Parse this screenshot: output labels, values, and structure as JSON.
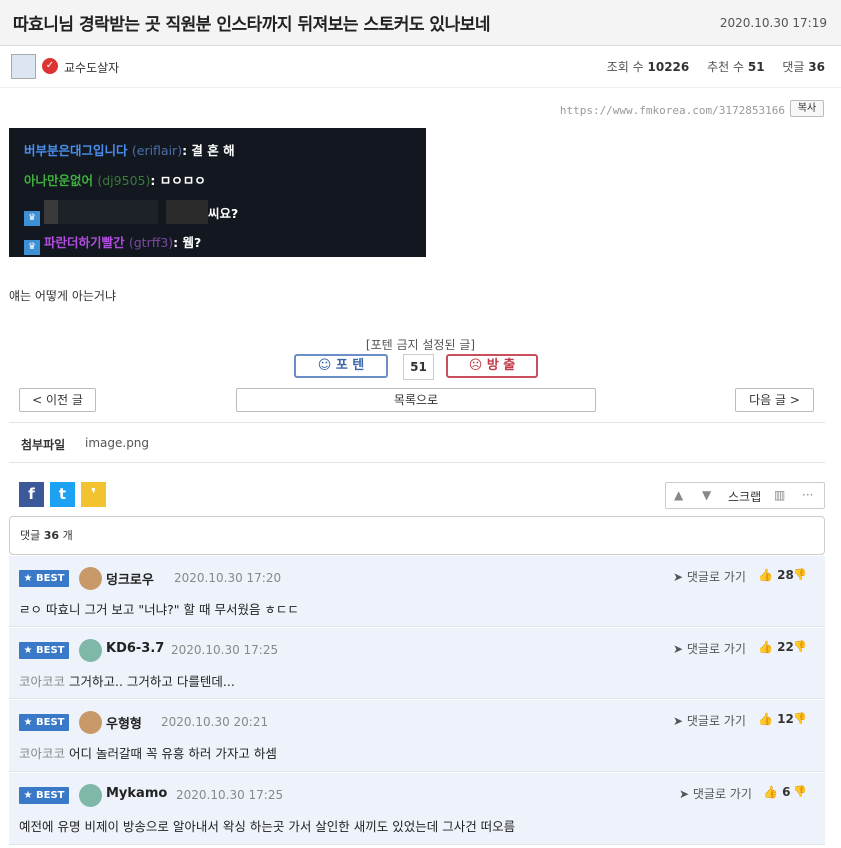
{
  "post": {
    "title": "따효니님 경락받는 곳 직원분 인스타까지 뒤져보는 스토커도 있나보네",
    "date": "2020.10.30 17:19",
    "author": "교수도살자",
    "views_label": "조회 수",
    "views": "10226",
    "recommend_label": "추천 수",
    "recommend": "51",
    "comments_label": "댓글",
    "comments": "36",
    "url": "https://www.fmkorea.com/3172853166",
    "copy_label": "복사",
    "body": "얘는 어떻게 아는거냐"
  },
  "chat": [
    {
      "name": "버부분은대그입니다",
      "id": "(eriflair)",
      "msg": ": 결 혼 해",
      "color": "#4a8ff0"
    },
    {
      "name": "아나만운없어",
      "id": "(dj9505)",
      "msg": ": ㅁㅇㅁㅇ",
      "color": "#3fae3f"
    },
    {
      "name": "",
      "id": "",
      "msg": "씨요?",
      "color": "#ffffff"
    },
    {
      "name": "파란더하기빨간",
      "id": "(gtrff3)",
      "msg": ": 웸?",
      "color": "#b14de0"
    }
  ],
  "vote": {
    "notice": "[포텐 금지 설정된 글]",
    "up_label": "포 텐",
    "count": "51",
    "down_label": "방 출"
  },
  "nav": {
    "prev": "< 이전 글",
    "list": "목록으로",
    "next": "다음 글 >"
  },
  "attach": {
    "label": "첨부파일",
    "file": "image.png"
  },
  "tools": {
    "scrap": "스크랩"
  },
  "comments_header": {
    "prefix": "댓글",
    "count": "36",
    "suffix": "개"
  },
  "best_label": "BEST",
  "goto_label": "댓글로 가기",
  "comments": [
    {
      "name": "덩크로우",
      "date": "2020.10.30 17:20",
      "likes": "28",
      "quote": "",
      "text": "ㄹㅇ 따효니 그거 보고 \"너냐?\" 할 때 무서웠음 ㅎㄷㄷ"
    },
    {
      "name": "KD6-3.7",
      "date": "2020.10.30 17:25",
      "likes": "22",
      "quote": "코아코코",
      "text": "그거하고.. 그거하고 다를텐데..."
    },
    {
      "name": "우형형",
      "date": "2020.10.30 20:21",
      "likes": "12",
      "quote": "코아코코",
      "text": "어디 놀러갈때 꼭 유흥 하러 가자고 하셈"
    },
    {
      "name": "Mykamo",
      "date": "2020.10.30 17:25",
      "likes": "6",
      "quote": "",
      "text": "예전에 유명 비제이 방송으로 알아내서 왁싱 하는곳 가서 살인한 새끼도 있었는데 그사건 떠오름"
    }
  ]
}
